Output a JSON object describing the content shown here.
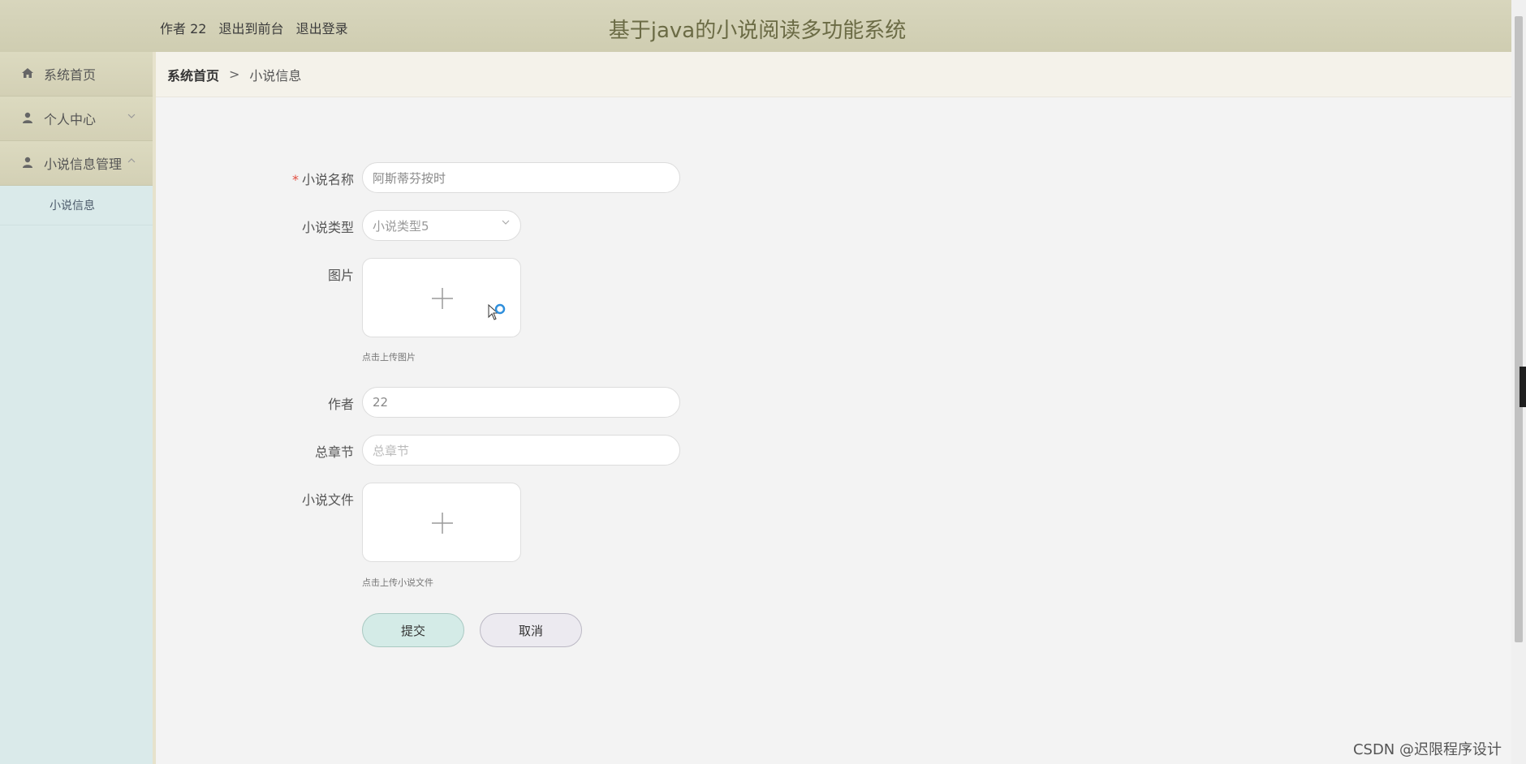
{
  "header": {
    "user_label": "作者 22",
    "to_front_link": "退出到前台",
    "logout_link": "退出登录",
    "title": "基于java的小说阅读多功能系统"
  },
  "sidebar": {
    "items": [
      {
        "label": "系统首页",
        "icon": "home-icon"
      },
      {
        "label": "个人中心",
        "icon": "user-icon",
        "chevron": "chevron-down-icon"
      },
      {
        "label": "小说信息管理",
        "icon": "user-icon",
        "chevron": "chevron-up-icon"
      }
    ],
    "subitems": [
      {
        "label": "小说信息"
      }
    ]
  },
  "breadcrumb": {
    "home": "系统首页",
    "separator": ">",
    "current": "小说信息"
  },
  "form": {
    "name_label": "小说名称",
    "name_required_mark": "*",
    "name_value": "阿斯蒂芬按时",
    "type_label": "小说类型",
    "type_value": "小说类型5",
    "image_label": "图片",
    "image_hint": "点击上传图片",
    "author_label": "作者",
    "author_value": "22",
    "chapters_label": "总章节",
    "chapters_placeholder": "总章节",
    "file_label": "小说文件",
    "file_hint": "点击上传小说文件",
    "submit_label": "提交",
    "cancel_label": "取消"
  },
  "watermark": "CSDN @迟限程序设计",
  "colors": {
    "header_bg": "#d8d6bd",
    "sidebar_bg": "#daeaea",
    "title_color": "#6b6b45",
    "submit_bg": "#d4ebe7",
    "required": "#e24c3f"
  }
}
